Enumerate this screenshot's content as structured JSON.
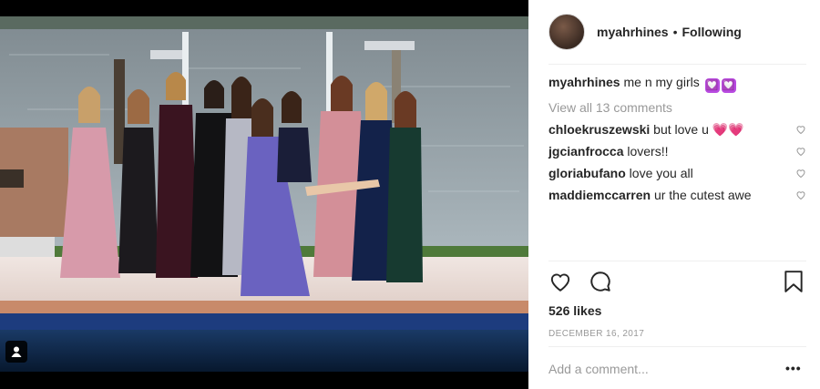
{
  "post": {
    "username": "myahrhines",
    "separator": "•",
    "follow_status": "Following",
    "caption_text": "me n my girls",
    "caption_emojis": [
      "💟",
      "💟"
    ],
    "view_all": "View all 13 comments",
    "comments": [
      {
        "user": "chloekruszewski",
        "text": "but love u",
        "emoji": "💗💗"
      },
      {
        "user": "jgcianfrocca",
        "text": "lovers!!",
        "emoji": ""
      },
      {
        "user": "gloriabufano",
        "text": "love you all",
        "emoji": ""
      },
      {
        "user": "maddiemccarren",
        "text": "ur the cutest awe",
        "emoji": ""
      }
    ],
    "likes": "526 likes",
    "date": "DECEMBER 16, 2017",
    "add_comment_placeholder": "Add a comment...",
    "more_label": "•••"
  },
  "icons": [
    "heart-icon",
    "comment-icon",
    "bookmark-icon",
    "tagged-user-icon"
  ],
  "colors": {
    "text": "#262626",
    "muted": "#999999",
    "divider": "#efefef",
    "heart_emoji": "#ff3ea5"
  }
}
